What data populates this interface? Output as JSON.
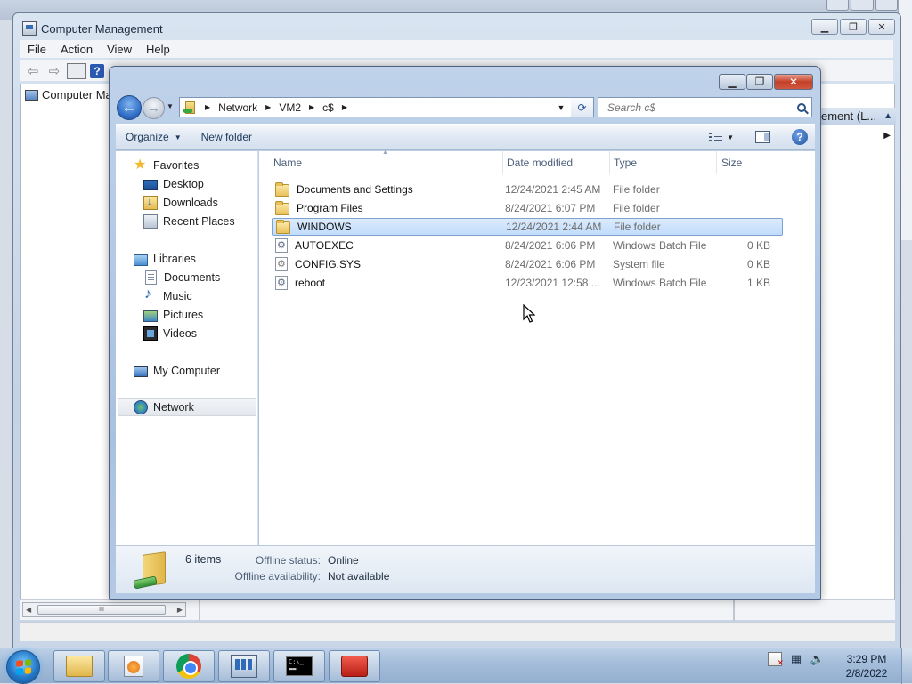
{
  "colors": {
    "accent": "#2a67c2",
    "selection": "#c1dcfc",
    "close_button": "#c4402a"
  },
  "cm": {
    "title": "Computer Management",
    "menu": [
      "File",
      "Action",
      "View",
      "Help"
    ],
    "tree_item": "Computer Ma",
    "actions_header": "ement (L...",
    "scroll_grip": "III"
  },
  "explorer": {
    "breadcrumb": [
      "Network",
      "VM2",
      "c$"
    ],
    "search_placeholder": "Search c$",
    "organize_label": "Organize",
    "new_folder_label": "New folder",
    "nav": {
      "favorites": "Favorites",
      "desktop": "Desktop",
      "downloads": "Downloads",
      "recent": "Recent Places",
      "libraries": "Libraries",
      "documents": "Documents",
      "music": "Music",
      "pictures": "Pictures",
      "videos": "Videos",
      "computer": "My Computer",
      "network": "Network"
    },
    "columns": {
      "name": "Name",
      "date": "Date modified",
      "type": "Type",
      "size": "Size"
    },
    "files": [
      {
        "name": "Documents and Settings",
        "date": "12/24/2021 2:45 AM",
        "type": "File folder",
        "size": "",
        "icon": "folder-icon"
      },
      {
        "name": "Program Files",
        "date": "8/24/2021 6:07 PM",
        "type": "File folder",
        "size": "",
        "icon": "folder-icon"
      },
      {
        "name": "WINDOWS",
        "date": "12/24/2021 2:44 AM",
        "type": "File folder",
        "size": "",
        "icon": "folder-icon"
      },
      {
        "name": "AUTOEXEC",
        "date": "8/24/2021 6:06 PM",
        "type": "Windows Batch File",
        "size": "0 KB",
        "icon": "batch-file-icon"
      },
      {
        "name": "CONFIG.SYS",
        "date": "8/24/2021 6:06 PM",
        "type": "System file",
        "size": "0 KB",
        "icon": "system-file-icon"
      },
      {
        "name": "reboot",
        "date": "12/23/2021 12:58 ...",
        "type": "Windows Batch File",
        "size": "1 KB",
        "icon": "batch-file-icon"
      }
    ],
    "details": {
      "count": "6 items",
      "offline_status_label": "Offline status:",
      "offline_status_value": "Online",
      "offline_avail_label": "Offline availability:",
      "offline_avail_value": "Not available"
    }
  },
  "taskbar": {
    "time": "3:29 PM",
    "date": "2/8/2022"
  }
}
